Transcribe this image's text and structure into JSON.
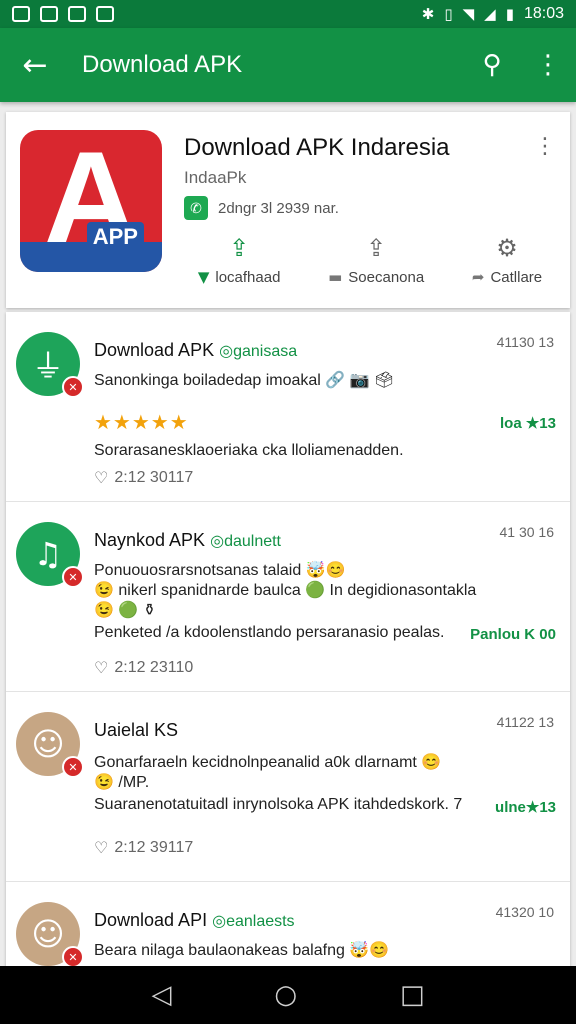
{
  "status_bar": {
    "time": "18:03",
    "left_icons": [
      "image-icon",
      "photo-icon",
      "mail-icon",
      "bag-icon"
    ],
    "right_icons": [
      "bluetooth-icon",
      "vibrate-icon",
      "wifi-icon",
      "signal-icon",
      "battery-icon"
    ]
  },
  "app_bar": {
    "title": "Download APK",
    "background": "#129145"
  },
  "app": {
    "title": "Download APK Indaresia",
    "developer": "IndaaPk",
    "meta": "2dngr 3l 2939 nar.",
    "logo_text": "APP",
    "actions": [
      {
        "icon": "share-icon",
        "label": "locafhaad",
        "label_icon": "download-icon"
      },
      {
        "icon": "share-alt-icon",
        "label": "Soecanona",
        "label_icon": "comment-icon"
      },
      {
        "icon": "settings-icon",
        "label": "Catllare",
        "label_icon": "forward-icon"
      }
    ]
  },
  "reviews": [
    {
      "name": "Download APK",
      "sub": "ganisasa",
      "time": "41130 13",
      "line1": "Sanonkinga boiladedap imoakal 🔗 📷 🗳",
      "stars": "★★★★★",
      "tag": "loa ★13",
      "line2": "Sorarasanesklaoeriaka cka lloliamenadden.",
      "foot": "2:12 30117"
    },
    {
      "name": "Naynkod APK",
      "sub": "daulnett",
      "time": "41 30 16",
      "line1": "Ponuouosrarsnotsanas talaid 🤯😊",
      "line1b": "😉 nikerl spanidnarde baulca 🟢 In degidionasontakla",
      "line1c": "😉 🟢 ⚱",
      "line2": "Penketed /a kdoolenstlando persaranasio pealas.",
      "tag": "Panlou K 00",
      "foot": "2:12 23110"
    },
    {
      "name": "Uaielal KS",
      "sub": "",
      "time": "41122 13",
      "line1": "Gonarfaraeln kecidnolnpeanalid a0k dlarnamt 😊",
      "line1b": "😉 /MP.",
      "line2": "Suaranenotatuitadl inrynolsoka APK itahdedskork. 7",
      "tag": "ulne★13",
      "foot": "2:12 39117"
    },
    {
      "name": "Download API",
      "sub": "eanlaests",
      "time": "41320 10",
      "line1": "Beara nilaga baulaonakeas balafng 🤯😊"
    }
  ],
  "nav_bar": {
    "back": "◁",
    "home": "○",
    "recents": "□"
  }
}
